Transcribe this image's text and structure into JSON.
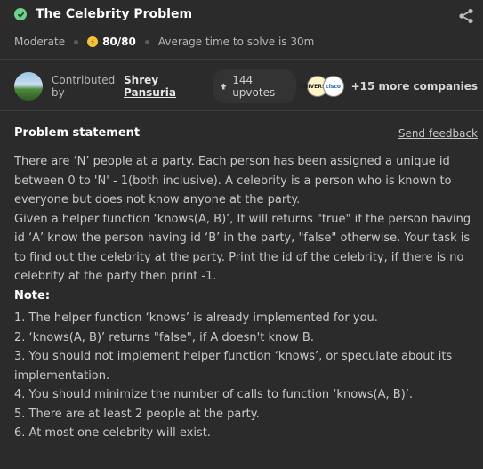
{
  "header": {
    "title": "The Celebrity Problem",
    "difficulty": "Moderate",
    "score": "80/80",
    "avg_time": "Average time to solve is 30m"
  },
  "contributor": {
    "label": "Contributed by",
    "name": "Shrey Pansuria",
    "upvotes": "144 upvotes",
    "companies": [
      "UNIVERSITY",
      "cisco"
    ],
    "more_companies": "+15 more companies"
  },
  "problem": {
    "heading": "Problem statement",
    "feedback": "Send feedback",
    "paragraph1": "There are ‘N’ people at a party. Each person has been assigned a unique id between 0 to 'N' - 1(both inclusive). A celebrity is a person who is known to everyone but does not know anyone at the party.",
    "paragraph2": "Given a helper function ‘knows(A, B)’, It will returns \"true\" if the person having id ‘A’ know the person having id ‘B’ in the party, \"false\" otherwise. Your task is to find out the celebrity at the party. Print the id of the celebrity, if there is no celebrity at the party then print -1.",
    "note_label": "Note:",
    "notes": [
      "1. The helper function ‘knows’ is already implemented for you.",
      "2. ‘knows(A, B)’ returns \"false\", if A doesn't know B.",
      "3. You should not implement helper function ‘knows’, or speculate about its implementation.",
      "4. You should minimize the number of calls to function ‘knows(A, B)’.",
      "5. There are at least 2 people at the party.",
      "6. At most one celebrity will exist."
    ]
  },
  "colors": {
    "background": "#2b2b2b",
    "solved_check": "#6fd08c",
    "coin": "#f3c33b"
  }
}
